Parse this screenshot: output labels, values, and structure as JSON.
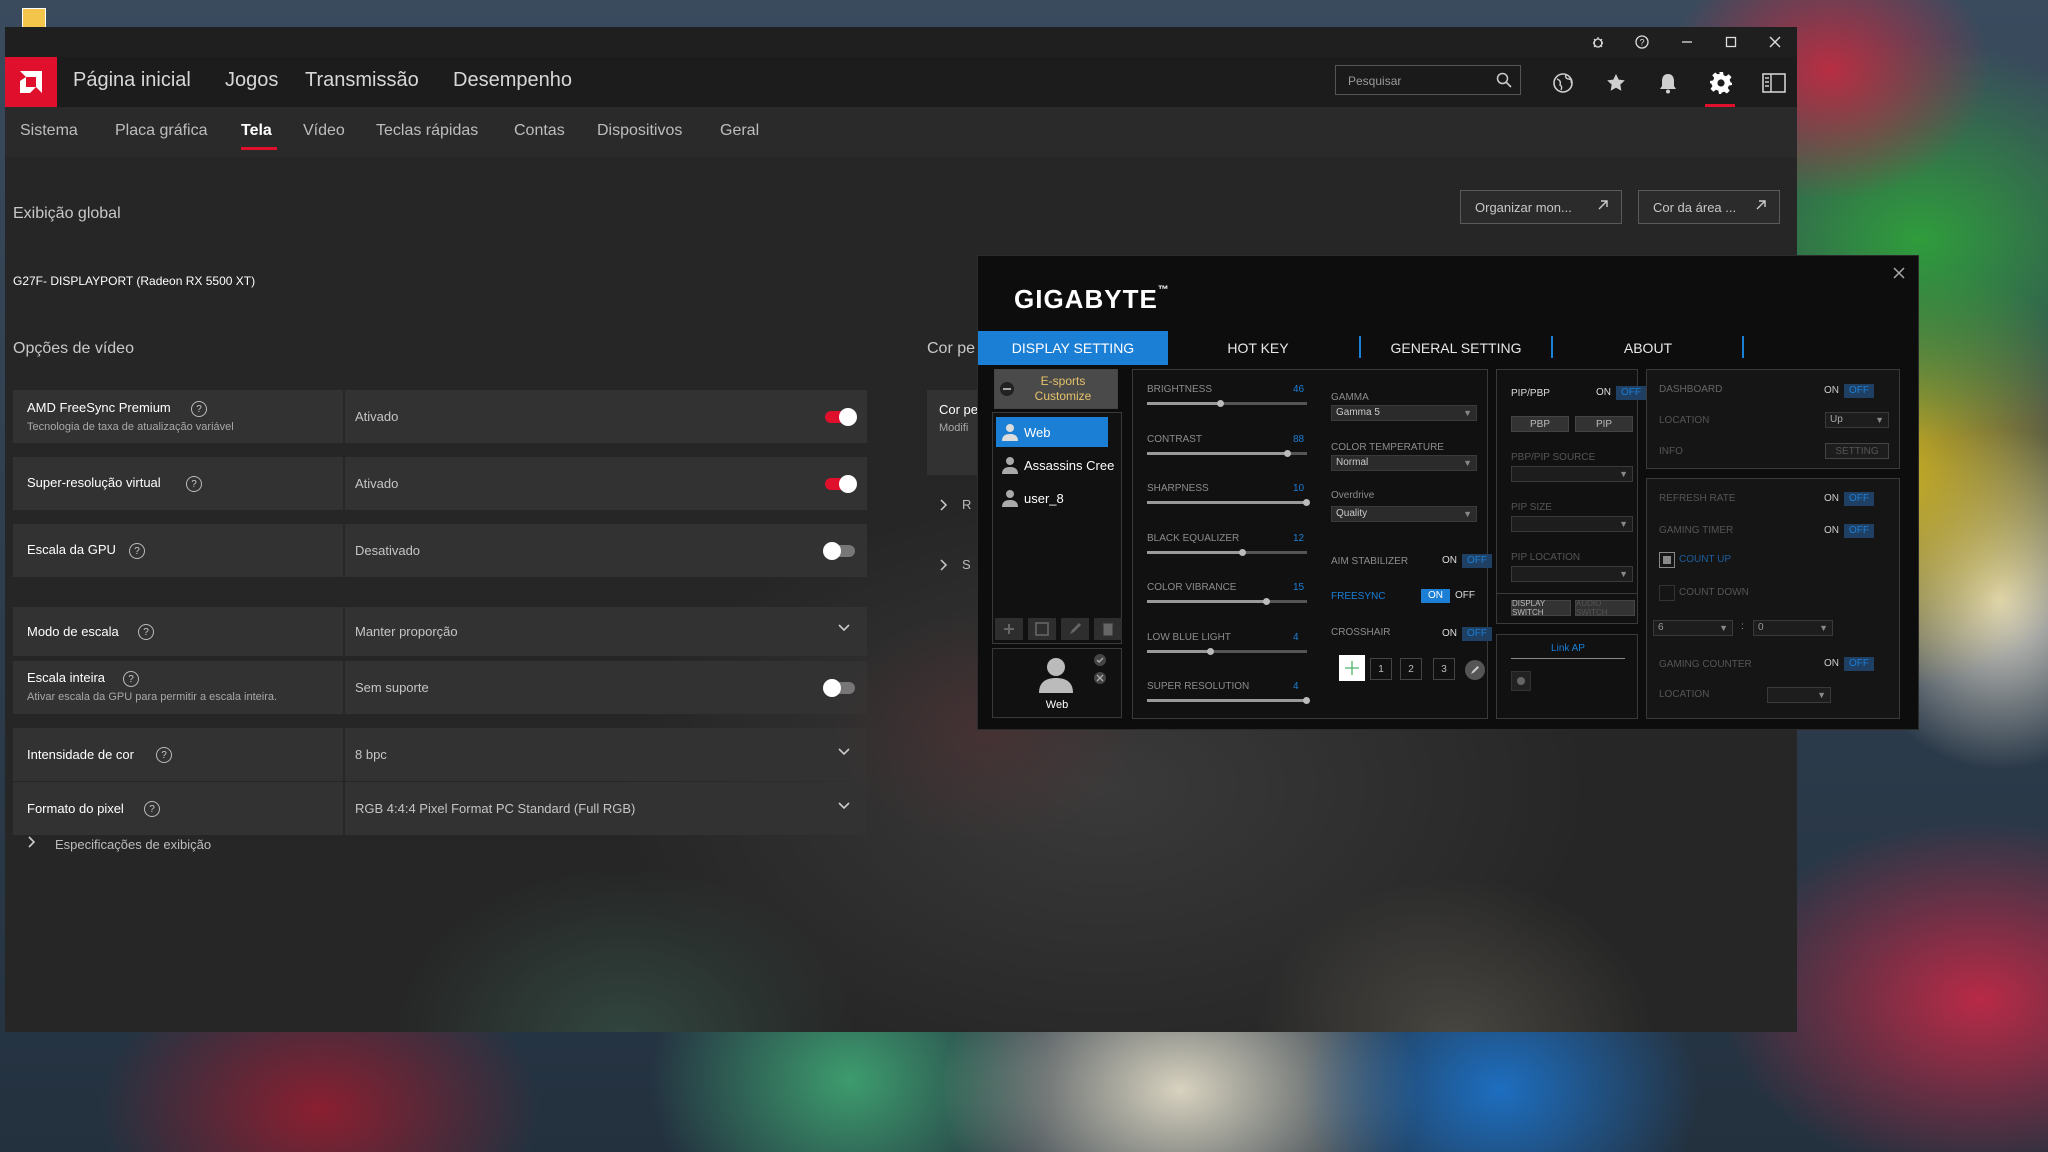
{
  "window": {
    "controls": [
      "bug-icon",
      "help-icon",
      "minimize-icon",
      "maximize-icon",
      "close-icon"
    ]
  },
  "nav": {
    "items": [
      "Página inicial",
      "Jogos",
      "Transmissão",
      "Desempenho"
    ],
    "search_placeholder": "Pesquisar",
    "icons": [
      "globe-icon",
      "star-icon",
      "bell-icon",
      "gear-icon",
      "sidebar-icon"
    ],
    "accent": "#e0102c"
  },
  "subnav": {
    "items": [
      "Sistema",
      "Placa gráfica",
      "Tela",
      "Vídeo",
      "Teclas rápidas",
      "Contas",
      "Dispositivos",
      "Geral"
    ],
    "active": "Tela"
  },
  "global": {
    "heading": "Exibição global",
    "organize_button": "Organizar mon...",
    "color_button": "Cor da área ...",
    "display_name": "G27F- DISPLAYPORT (Radeon RX 5500 XT)"
  },
  "video_options": {
    "heading": "Opções de vídeo",
    "rows": [
      {
        "label": "AMD FreeSync Premium",
        "desc": "Tecnologia de taxa de atualização variável",
        "value": "Ativado",
        "control": "toggle",
        "on": true
      },
      {
        "label": "Super-resolução virtual",
        "desc": "",
        "value": "Ativado",
        "control": "toggle",
        "on": true
      },
      {
        "label": "Escala da GPU",
        "desc": "",
        "value": "Desativado",
        "control": "toggle",
        "on": false
      },
      {
        "label": "Modo de escala",
        "desc": "",
        "value": "Manter proporção",
        "control": "dropdown"
      },
      {
        "label": "Escala inteira",
        "desc": "Ativar escala da GPU para permitir a escala inteira.",
        "value": "Sem suporte",
        "control": "toggle",
        "on": false
      },
      {
        "label": "Intensidade de cor",
        "desc": "",
        "value": "8 bpc",
        "control": "dropdown"
      },
      {
        "label": "Formato do pixel",
        "desc": "",
        "value": "RGB 4:4:4 Pixel Format PC Standard (Full RGB)",
        "control": "dropdown"
      }
    ],
    "specs_link": "Especificações de exibição"
  },
  "color_panel": {
    "heading": "Cor pe",
    "row_label": "Cor pe",
    "row_desc": "Modifi",
    "sub1": "R",
    "sub2": "S"
  },
  "gigabyte": {
    "logo": "GIGABYTE",
    "trademark": "™",
    "tabs": [
      "DISPLAY SETTING",
      "HOT KEY",
      "GENERAL SETTING",
      "ABOUT"
    ],
    "active_tab": "DISPLAY SETTING",
    "mode_button": "E-sports\nCustomize",
    "profiles": [
      "Web",
      "Assassins Cree",
      "user_8"
    ],
    "active_profile": "Web",
    "profile_caption": "Web",
    "sliders": [
      {
        "label": "BRIGHTNESS",
        "value": "46",
        "level": 0.46
      },
      {
        "label": "CONTRAST",
        "value": "88",
        "level": 0.88
      },
      {
        "label": "SHARPNESS",
        "value": "10",
        "level": 1.0
      },
      {
        "label": "BLACK EQUALIZER",
        "value": "12",
        "level": 0.6
      },
      {
        "label": "COLOR VIBRANCE",
        "value": "15",
        "level": 0.75
      },
      {
        "label": "LOW BLUE LIGHT",
        "value": "4",
        "level": 0.4
      },
      {
        "label": "SUPER RESOLUTION",
        "value": "4",
        "level": 1.0
      }
    ],
    "gamma": {
      "label": "GAMMA",
      "value": "Gamma 5"
    },
    "color_temp": {
      "label": "COLOR TEMPERATURE",
      "value": "Normal"
    },
    "overdrive": {
      "label": "Overdrive",
      "value": "Quality"
    },
    "aim_stabilizer": "AIM STABILIZER",
    "freesync": "FREESYNC",
    "crosshair": "CROSSHAIR",
    "on": "ON",
    "off": "OFF",
    "crosshair_opts": [
      "1",
      "2",
      "3"
    ],
    "pip": {
      "title": "PIP/PBP",
      "pbp": "PBP",
      "pip": "PIP",
      "source": "PBP/PIP SOURCE",
      "size": "PIP SIZE",
      "location": "PIP LOCATION",
      "display_switch": "DISPLAY SWITCH",
      "audio_switch": "AUDIO SWITCH",
      "link_ap": "Link AP"
    },
    "dashboard": {
      "label": "DASHBOARD",
      "location_label": "LOCATION",
      "location_value": "Up",
      "info_label": "INFO",
      "setting": "SETTING"
    },
    "gaming": {
      "refresh_rate": "REFRESH RATE",
      "timer": "GAMING TIMER",
      "count_up": "COUNT UP",
      "count_down": "COUNT DOWN",
      "min": "6",
      "sep": ":",
      "sec": "0",
      "counter": "GAMING COUNTER",
      "location": "LOCATION"
    },
    "blue": "#1b7fd6"
  }
}
